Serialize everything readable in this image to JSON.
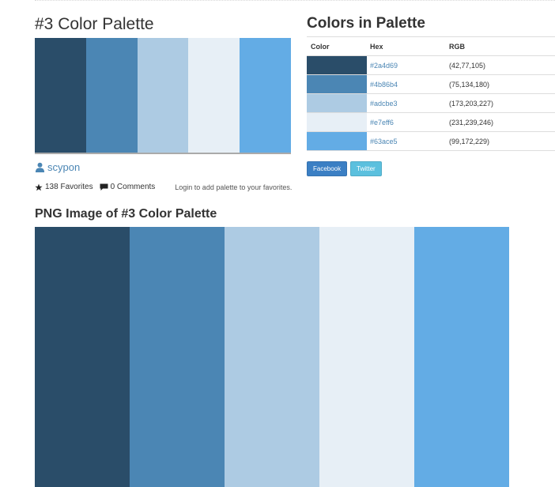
{
  "palette": {
    "title": "#3 Color Palette",
    "colors": [
      "#2a4d69",
      "#4b86b4",
      "#adcbe3",
      "#e7eff6",
      "#63ace5"
    ]
  },
  "author": {
    "icon": "user-icon",
    "name": "scypon"
  },
  "meta": {
    "favorites_icon": "star-icon",
    "favorites": "138 Favorites",
    "comments_icon": "comment-icon",
    "comments": "0 Comments",
    "login_hint": "Login to add palette to your favorites."
  },
  "colors_panel": {
    "title": "Colors in Palette",
    "headers": {
      "color": "Color",
      "hex": "Hex",
      "rgb": "RGB"
    },
    "rows": [
      {
        "swatch": "#2a4d69",
        "hex": "#2a4d69",
        "rgb": "(42,77,105)"
      },
      {
        "swatch": "#4b86b4",
        "hex": "#4b86b4",
        "rgb": "(75,134,180)"
      },
      {
        "swatch": "#adcbe3",
        "hex": "#adcbe3",
        "rgb": "(173,203,227)"
      },
      {
        "swatch": "#e7eff6",
        "hex": "#e7eff6",
        "rgb": "(231,239,246)"
      },
      {
        "swatch": "#63ace5",
        "hex": "#63ace5",
        "rgb": "(99,172,229)"
      }
    ]
  },
  "share": {
    "facebook": "Facebook",
    "twitter": "Twitter"
  },
  "png": {
    "title": "PNG Image of #3 Color Palette"
  },
  "theme": {
    "link": "#4b86b4",
    "facebook": "#3b7fc4",
    "twitter": "#5bc0de"
  }
}
